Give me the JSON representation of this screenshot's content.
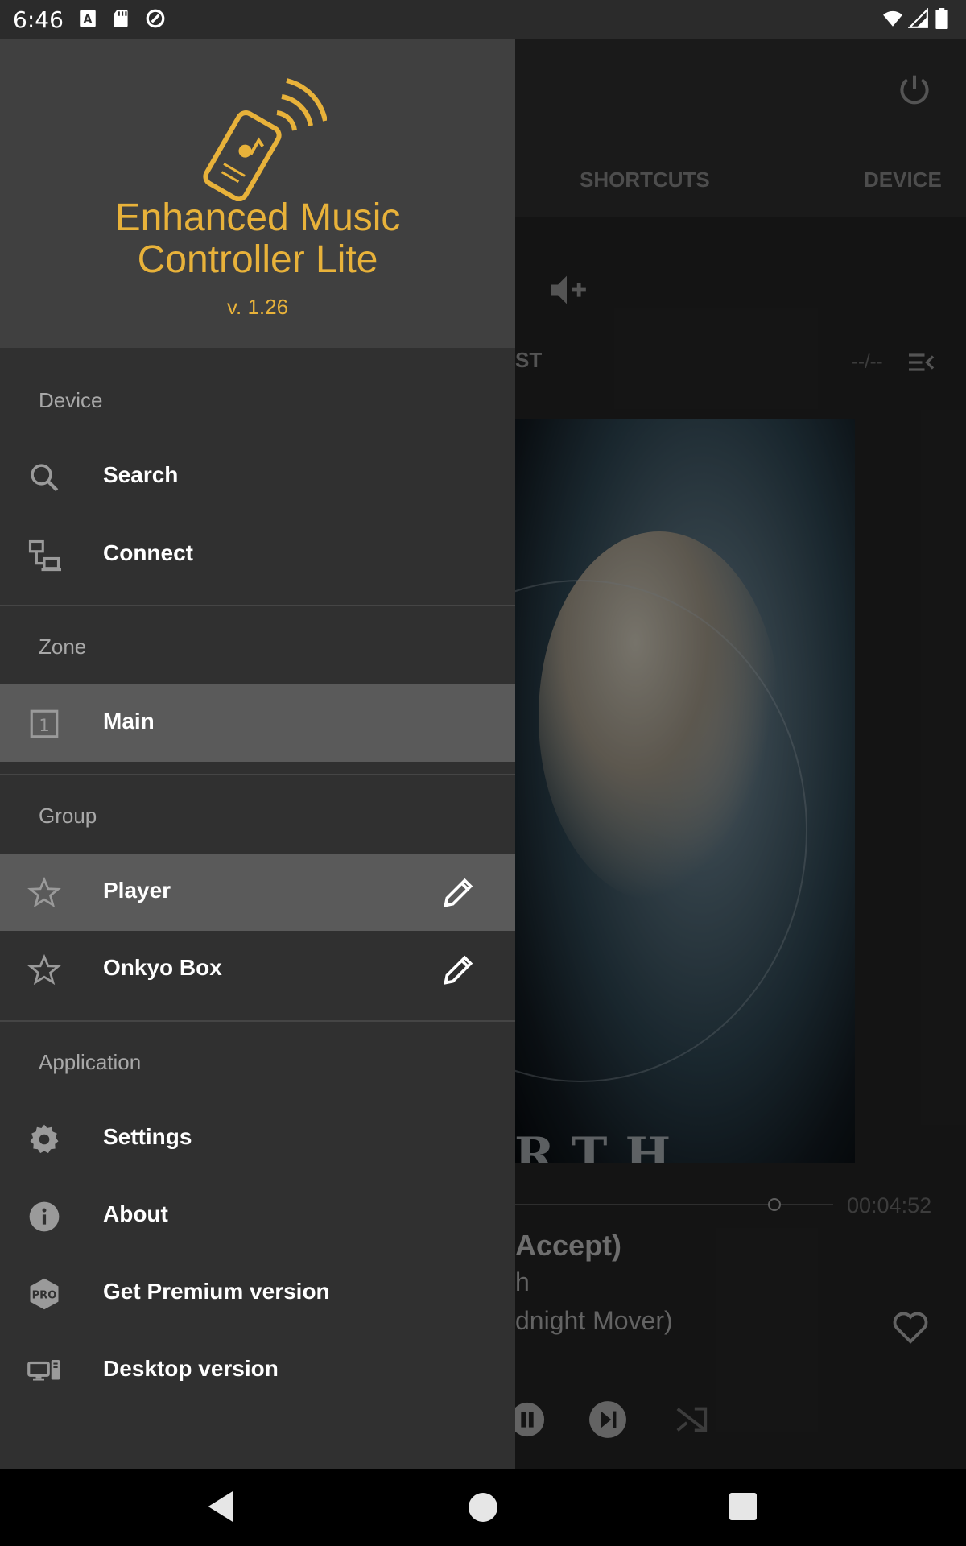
{
  "status_bar": {
    "time": "6:46"
  },
  "background": {
    "tabs": [
      "SHORTCUTS",
      "DEVICE"
    ],
    "playlist_fragment": "ST",
    "track_counter": "--/--",
    "time_total": "00:04:52",
    "track_title_fragment": "Accept)",
    "artist_fragment": "h",
    "album_fragment": "dnight Mover)",
    "album_art_text": "RTH"
  },
  "drawer": {
    "app_name_line1": "Enhanced Music",
    "app_name_line2": "Controller Lite",
    "version": "v. 1.26",
    "sections": {
      "device": {
        "title": "Device",
        "items": [
          {
            "label": "Search",
            "icon": "search-icon"
          },
          {
            "label": "Connect",
            "icon": "connect-icon"
          }
        ]
      },
      "zone": {
        "title": "Zone",
        "items": [
          {
            "label": "Main",
            "icon": "zone-1-icon",
            "badge": "1",
            "selected": true
          }
        ]
      },
      "group": {
        "title": "Group",
        "items": [
          {
            "label": "Player",
            "icon": "star-icon",
            "selected": true
          },
          {
            "label": "Onkyo Box",
            "icon": "star-icon"
          }
        ]
      },
      "application": {
        "title": "Application",
        "items": [
          {
            "label": "Settings",
            "icon": "gear-icon"
          },
          {
            "label": "About",
            "icon": "info-icon"
          },
          {
            "label": "Get Premium version",
            "icon": "pro-icon",
            "badge": "PRO"
          },
          {
            "label": "Desktop version",
            "icon": "desktop-icon"
          }
        ]
      }
    }
  },
  "colors": {
    "accent": "#e8b23a",
    "drawer_bg": "#303030",
    "header_bg": "#404040",
    "selected_bg": "#5a5a5a"
  }
}
